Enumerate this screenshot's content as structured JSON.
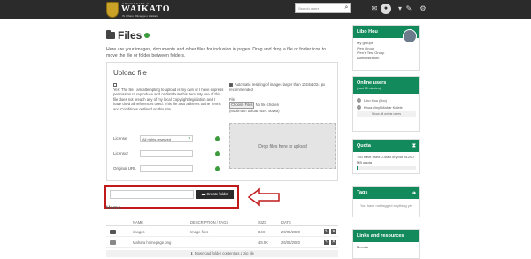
{
  "header": {
    "brand_line1": "UNIVERSITY OF",
    "brand_line2": "WAIKATO",
    "brand_line3": "Te Whare Wānanga o Waikato",
    "search_placeholder": "Search users",
    "search_icon": "search-icon",
    "icons": [
      "envelope-icon",
      "user-icon",
      "pen-icon",
      "gear-icon"
    ]
  },
  "page": {
    "title": "Files",
    "intro": "Here are your images, documents and other files for inclusion in pages. Drag and drop a file or folder icon to move the file or folder between folders."
  },
  "upload": {
    "heading": "Upload file",
    "terms_text": "Yes: The file I am attempting to upload is my own or I have express permission to reproduce and or distribute this item. My use of this file does not breach any of my local Copyright legislation and I have cited all references used. This file also adheres to the Terms and Conditions outlined on this site.",
    "auto_resize_text": "Automatic resizing of images larger than 1024x1024 px recommended",
    "file_label": "File",
    "choose_button": "Choose Files",
    "no_file_text": "No file chosen",
    "max_upload": "(Maximum upload size: 50MB)",
    "dropzone_text": "Drop files here to upload",
    "license_label": "License",
    "license_value": "All rights reserved",
    "licensor_label": "Licensor",
    "original_url_label": "Original URL"
  },
  "create_folder": {
    "button_label": "Create folder",
    "button_icon": "folder-icon"
  },
  "files_table": {
    "home_label": "Home",
    "columns": [
      "NAME",
      "DESCRIPTION / TAGS",
      "SIZE",
      "DATE"
    ],
    "rows": [
      {
        "icon": "folder-icon",
        "name": "images",
        "description": "Image files",
        "size": "84K",
        "date": "20/06/2020"
      },
      {
        "icon": "image-icon",
        "name": "Mahara homepage.png",
        "description": "",
        "size": "48.5K",
        "date": "26/06/2020"
      }
    ],
    "download_label": "Download folder content as a zip file"
  },
  "sidebar": {
    "profile": {
      "name": "Libo Hou",
      "lines": [
        "My groups",
        "iPen Group",
        "iPen's Test Group",
        "Administration"
      ]
    },
    "online_users": {
      "title": "Online users",
      "subtitle": "(Last 10 minutes)",
      "users": [
        "Libo Hou (libo)",
        "Khoa Vinyl Mahar Kolele"
      ],
      "show_all": "Show all online users"
    },
    "quota": {
      "title": "Quota",
      "text": "You have used 0.4MB of your 51200 MB quota",
      "used_percent": 0
    },
    "tags": {
      "title": "Tags",
      "text": "You have not tagged anything yet"
    },
    "links": {
      "title": "Links and resources",
      "item": "Moodle"
    }
  },
  "colors": {
    "topbar": "#2b2b2b",
    "accent_green": "#138a5c",
    "highlight_red": "#c01a1a"
  }
}
